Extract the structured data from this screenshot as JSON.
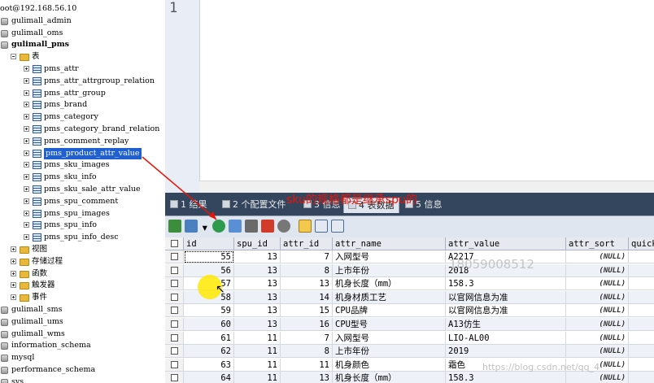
{
  "tree": {
    "items": [
      {
        "label": "oot@192.168.56.10",
        "type": "root",
        "level": 0
      },
      {
        "label": "gulimall_admin",
        "type": "db",
        "level": 0
      },
      {
        "label": "gulimall_oms",
        "type": "db",
        "level": 0
      },
      {
        "label": "gulimall_pms",
        "type": "db",
        "level": 0,
        "bold": true,
        "expanded": true
      },
      {
        "label": "表",
        "type": "folder",
        "level": 1,
        "expanded": true
      },
      {
        "label": "pms_attr",
        "type": "table",
        "level": 2
      },
      {
        "label": "pms_attr_attrgroup_relation",
        "type": "table",
        "level": 2
      },
      {
        "label": "pms_attr_group",
        "type": "table",
        "level": 2
      },
      {
        "label": "pms_brand",
        "type": "table",
        "level": 2
      },
      {
        "label": "pms_category",
        "type": "table",
        "level": 2
      },
      {
        "label": "pms_category_brand_relation",
        "type": "table",
        "level": 2
      },
      {
        "label": "pms_comment_replay",
        "type": "table",
        "level": 2
      },
      {
        "label": "pms_product_attr_value",
        "type": "table",
        "level": 2,
        "selected": true
      },
      {
        "label": "pms_sku_images",
        "type": "table",
        "level": 2
      },
      {
        "label": "pms_sku_info",
        "type": "table",
        "level": 2
      },
      {
        "label": "pms_sku_sale_attr_value",
        "type": "table",
        "level": 2
      },
      {
        "label": "pms_spu_comment",
        "type": "table",
        "level": 2
      },
      {
        "label": "pms_spu_images",
        "type": "table",
        "level": 2
      },
      {
        "label": "pms_spu_info",
        "type": "table",
        "level": 2
      },
      {
        "label": "pms_spu_info_desc",
        "type": "table",
        "level": 2
      },
      {
        "label": "视图",
        "type": "folder",
        "level": 1
      },
      {
        "label": "存储过程",
        "type": "folder",
        "level": 1
      },
      {
        "label": "函数",
        "type": "folder",
        "level": 1
      },
      {
        "label": "触发器",
        "type": "folder",
        "level": 1
      },
      {
        "label": "事件",
        "type": "folder",
        "level": 1
      },
      {
        "label": "gulimall_sms",
        "type": "db",
        "level": 0
      },
      {
        "label": "gulimall_ums",
        "type": "db",
        "level": 0
      },
      {
        "label": "gulimall_wms",
        "type": "db",
        "level": 0
      },
      {
        "label": "information_schema",
        "type": "db",
        "level": 0
      },
      {
        "label": "mysql",
        "type": "db",
        "level": 0
      },
      {
        "label": "performance_schema",
        "type": "db",
        "level": 0
      },
      {
        "label": "sys",
        "type": "db",
        "level": 0
      }
    ]
  },
  "editor": {
    "line_number": "1"
  },
  "tabs": [
    {
      "label": "1 结果"
    },
    {
      "label": "2 个配置文件"
    },
    {
      "label": "3 信息"
    },
    {
      "label": "4 表数据",
      "active": true
    },
    {
      "label": "5 信息"
    }
  ],
  "annotation": "sku的规格都是继承spu的",
  "grid": {
    "columns": [
      "id",
      "spu_id",
      "attr_id",
      "attr_name",
      "attr_value",
      "attr_sort",
      "quick"
    ],
    "rows": [
      [
        "55",
        "13",
        "7",
        "入网型号",
        "A2217",
        "(NULL)",
        ""
      ],
      [
        "56",
        "13",
        "8",
        "上市年份",
        "2018",
        "(NULL)",
        ""
      ],
      [
        "57",
        "13",
        "13",
        "机身长度（mm）",
        "158.3",
        "(NULL)",
        ""
      ],
      [
        "58",
        "13",
        "14",
        "机身材质工艺",
        "以官网信息为准",
        "(NULL)",
        ""
      ],
      [
        "59",
        "13",
        "15",
        "CPU品牌",
        "以官网信息为准",
        "(NULL)",
        ""
      ],
      [
        "60",
        "13",
        "16",
        "CPU型号",
        "A13仿生",
        "(NULL)",
        ""
      ],
      [
        "61",
        "11",
        "7",
        "入网型号",
        "LIO-AL00",
        "(NULL)",
        ""
      ],
      [
        "62",
        "11",
        "8",
        "上市年份",
        "2019",
        "(NULL)",
        ""
      ],
      [
        "63",
        "11",
        "11",
        "机身颜色",
        "霜色",
        "(NULL)",
        ""
      ],
      [
        "64",
        "11",
        "13",
        "机身长度（mm）",
        "158.3",
        "(NULL)",
        ""
      ]
    ]
  },
  "watermarks": {
    "phone": "18059008512",
    "url": "https://blog.csdn.net/qq_4"
  },
  "colors": {
    "selection": "#1f5fd0",
    "annotation": "#e8140a",
    "panel": "#33465e"
  }
}
